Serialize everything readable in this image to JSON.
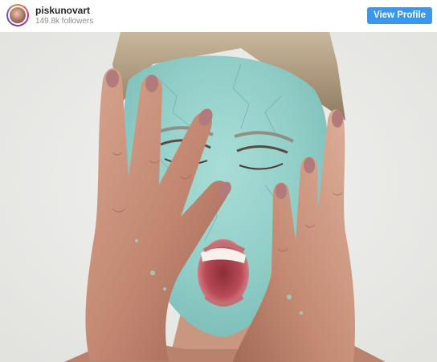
{
  "profile": {
    "username": "piskunovart",
    "followers": "149.8k followers",
    "view_profile_label": "View Profile"
  },
  "icons": {
    "avatar": "profile-avatar-icon"
  },
  "colors": {
    "button": "#3897f0",
    "username": "#262626",
    "followers": "#8e8e8e"
  }
}
